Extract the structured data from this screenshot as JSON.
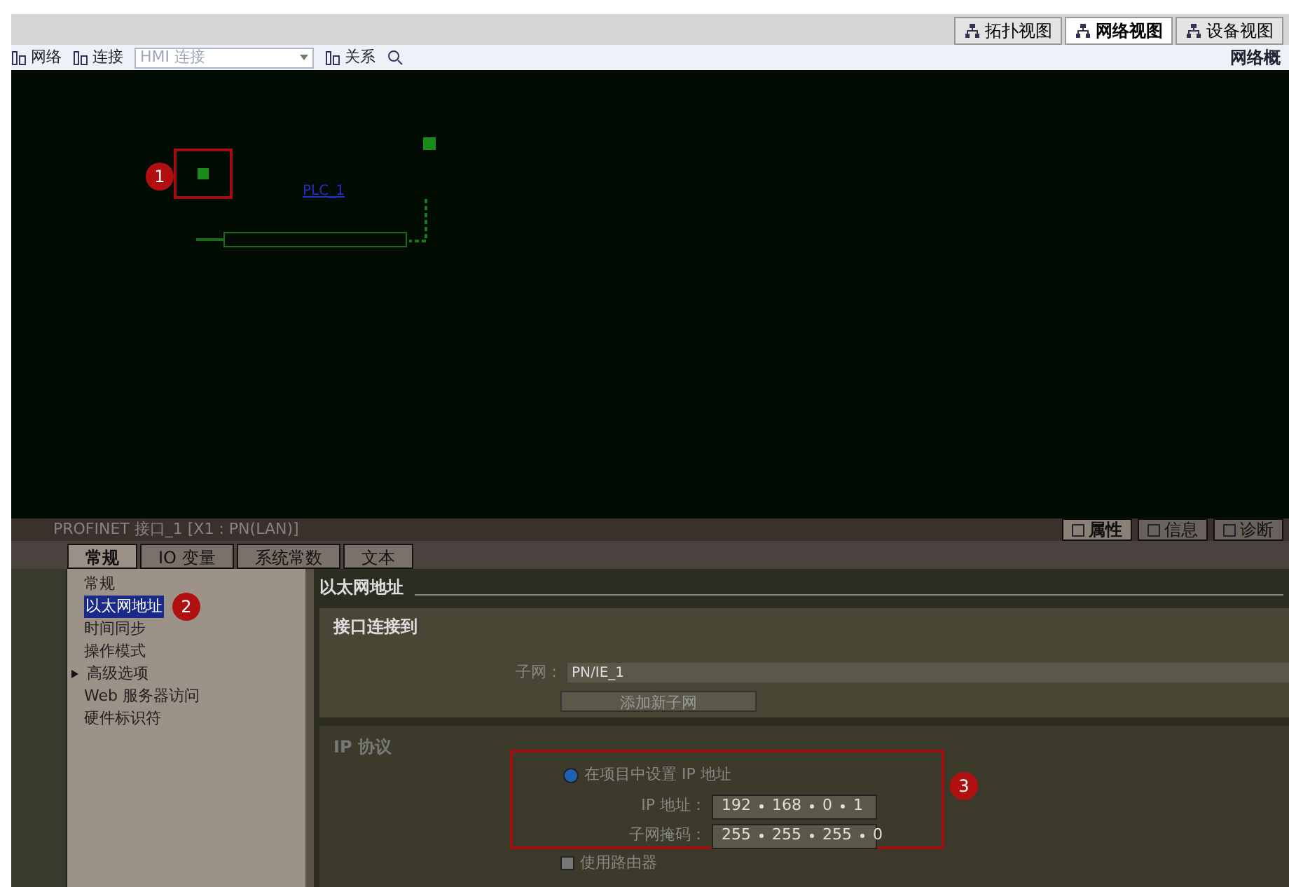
{
  "view_tabs": [
    {
      "label": "拓扑视图",
      "selected": false
    },
    {
      "label": "网络视图",
      "selected": true
    },
    {
      "label": "设备视图",
      "selected": false
    }
  ],
  "toolbar": {
    "items": [
      {
        "label": "网络",
        "kind": "tool"
      },
      {
        "label": "连接",
        "kind": "tool"
      },
      {
        "placeholder": "HMI 连接",
        "kind": "dropdown"
      },
      {
        "label": "关系",
        "kind": "tool"
      }
    ],
    "overview": "网络概"
  },
  "canvas": {
    "device_label": "PLC_1",
    "callout": "1"
  },
  "inspector": {
    "title": "PROFINET 接口_1 [X1 : PN(LAN)]",
    "side_tabs": [
      {
        "label": "属性",
        "selected": true
      },
      {
        "label": "信息",
        "selected": false
      },
      {
        "label": "诊断",
        "selected": false
      }
    ],
    "tabs": [
      {
        "label": "常规",
        "selected": true
      },
      {
        "label": "IO 变量",
        "selected": false
      },
      {
        "label": "系统常数",
        "selected": false
      },
      {
        "label": "文本",
        "selected": false
      }
    ],
    "nav": [
      {
        "label": "常规",
        "selected": false,
        "kind": "page"
      },
      {
        "label": "以太网地址",
        "selected": true,
        "kind": "page",
        "callout": "2"
      },
      {
        "label": "时间同步",
        "selected": false,
        "kind": "page"
      },
      {
        "label": "操作模式",
        "selected": false,
        "kind": "page"
      },
      {
        "label": "高级选项",
        "selected": false,
        "kind": "group",
        "expanded": false
      },
      {
        "label": "Web 服务器访问",
        "selected": false,
        "kind": "page"
      },
      {
        "label": "硬件标识符",
        "selected": false,
        "kind": "page"
      }
    ],
    "heading": "以太网地址",
    "interface_section": {
      "title": "接口连接到",
      "subnet_label": "子网：",
      "subnet_value": "PN/IE_1",
      "add_button": "添加新子网"
    },
    "ip_section": {
      "title": "IP 协议",
      "radio_label": "在项目中设置 IP 地址",
      "radio_selected": true,
      "callout": "3",
      "ip_label": "IP 地址：",
      "ip": [
        "192",
        "168",
        "0",
        "1"
      ],
      "mask_label": "子网掩码：",
      "mask": [
        "255",
        "255",
        "255",
        "0"
      ],
      "router_label": "使用路由器",
      "router_checked": false
    }
  }
}
